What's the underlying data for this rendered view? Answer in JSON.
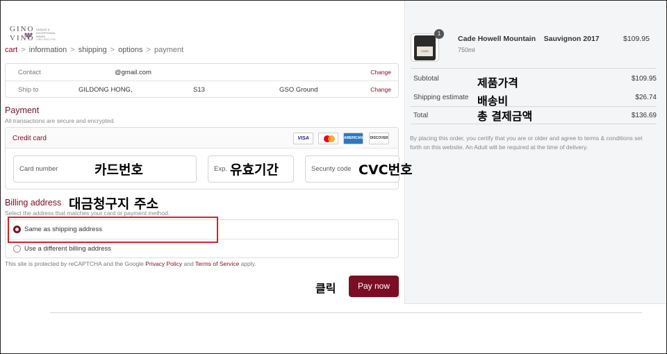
{
  "logo": {
    "line1": "GINO",
    "line2": "VINO",
    "tagline": "UNIQUE & EXCEPTIONAL WINES",
    "tagline2": "GINO VINO.COM"
  },
  "breadcrumb": [
    "cart",
    "information",
    "shipping",
    "options",
    "payment"
  ],
  "contact": {
    "contact_label": "Contact",
    "contact_value": "@gmail.com",
    "contact_change": "Change",
    "ship_label": "Ship to",
    "ship_name": "GILDONG HONG,",
    "ship_code": "S13",
    "ship_method": "GSO Ground",
    "ship_change": "Change"
  },
  "payment": {
    "title": "Payment",
    "subtitle": "All transactions are secure and encrypted.",
    "credit_card_label": "Credit card",
    "card_brands": [
      "VISA",
      "MasterCard",
      "AMERICAN EXPRESS",
      "DISCOVER"
    ],
    "card_number_placeholder": "Card number",
    "exp_placeholder": "Exp.",
    "security_placeholder": "Security code"
  },
  "billing": {
    "title": "Billing address",
    "subtitle": "Select the address that matches your card or payment method.",
    "option_same": "Same as shipping address",
    "option_different": "Use a different billing address",
    "selected": "same"
  },
  "recaptcha": {
    "prefix": "This site is protected by reCAPTCHA and the Google ",
    "privacy": "Privacy Policy",
    "and": " and ",
    "terms": "Terms of Service",
    "suffix": " apply."
  },
  "pay_button": "Pay now",
  "annotations": {
    "card_number": "카드번호",
    "expiry": "유효기간",
    "cvc": "CVC번호",
    "billing": "대금청구지 주소",
    "click": "클릭",
    "subtotal": "제품가격",
    "shipping": "배송비",
    "total": "총 결제금액"
  },
  "order": {
    "quantity": "1",
    "product_name": "Cade Howell Mountain    Sauvignon 2017",
    "bottle_label": "CADE",
    "volume": "750ml",
    "price": "$109.95",
    "subtotal_label": "Subtotal",
    "subtotal": "$109.95",
    "shipping_label": "Shipping estimate",
    "shipping": "$26.74",
    "total_label": "Total",
    "total": "$136.69",
    "legal": "By placing this order, you certify that you are or older and agree to terms & conditions set forth on this website. An Adult will be required at the time of delivery."
  },
  "colors": {
    "accent": "#7a0e24",
    "highlight": "#c7272a",
    "panel": "#f4f5f7"
  }
}
